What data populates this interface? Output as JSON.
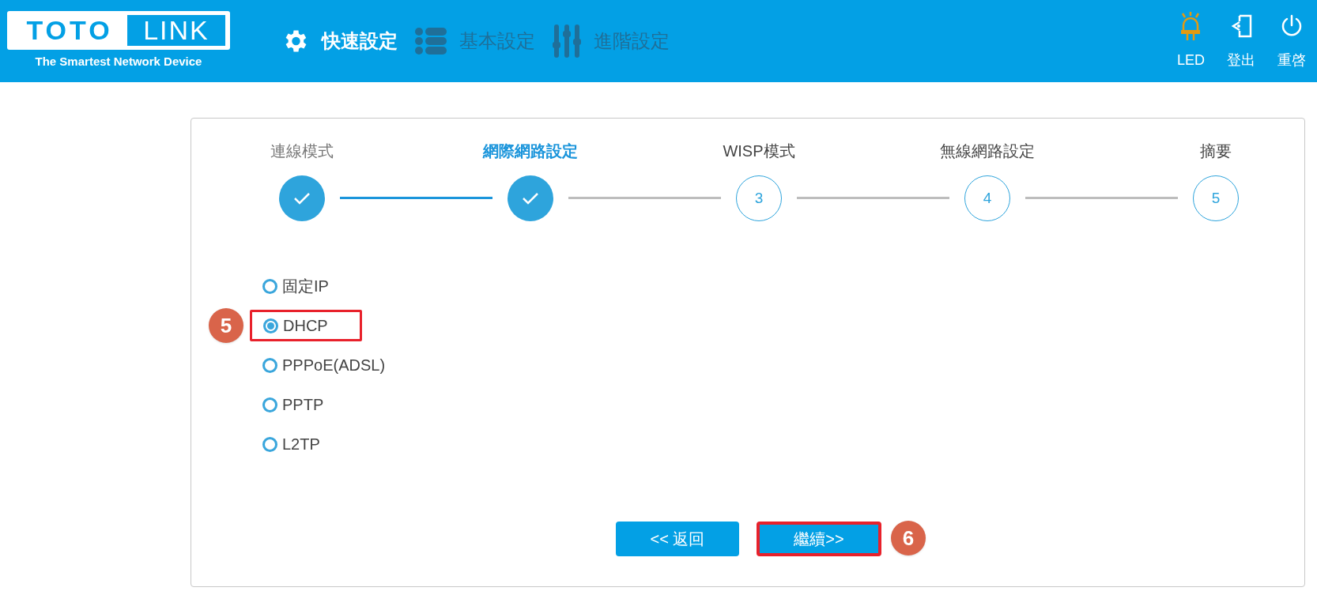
{
  "header": {
    "logo": {
      "left": "TOTO",
      "right": "LINK",
      "tagline": "The Smartest Network Device"
    },
    "nav": [
      {
        "label": "快速設定",
        "kind": "gear",
        "selected": true
      },
      {
        "label": "基本設定",
        "kind": "list",
        "selected": false
      },
      {
        "label": "進階設定",
        "kind": "sliders",
        "selected": false
      }
    ],
    "actions": [
      {
        "label": "LED",
        "kind": "led"
      },
      {
        "label": "登出",
        "kind": "logout"
      },
      {
        "label": "重啓",
        "kind": "power"
      }
    ]
  },
  "steps": [
    {
      "label": "連線模式",
      "kind": "done",
      "selected": false
    },
    {
      "label": "網際網路設定",
      "kind": "done",
      "selected": true
    },
    {
      "label": "WISP模式",
      "number": "3",
      "kind": "pending",
      "selected": false
    },
    {
      "label": "無線網路設定",
      "number": "4",
      "kind": "pending",
      "selected": false
    },
    {
      "label": "摘要",
      "number": "5",
      "kind": "pending",
      "selected": false
    }
  ],
  "options": [
    {
      "label": "固定IP",
      "selected": false,
      "highlighted": false
    },
    {
      "label": "DHCP",
      "selected": true,
      "highlighted": true,
      "marker": "5"
    },
    {
      "label": "PPPoE(ADSL)",
      "selected": false,
      "highlighted": false
    },
    {
      "label": "PPTP",
      "selected": false,
      "highlighted": false
    },
    {
      "label": "L2TP",
      "selected": false,
      "highlighted": false
    }
  ],
  "buttons": [
    {
      "label": "<< 返回",
      "highlighted": false
    },
    {
      "label": "繼續>>",
      "highlighted": true,
      "marker": "6"
    }
  ]
}
